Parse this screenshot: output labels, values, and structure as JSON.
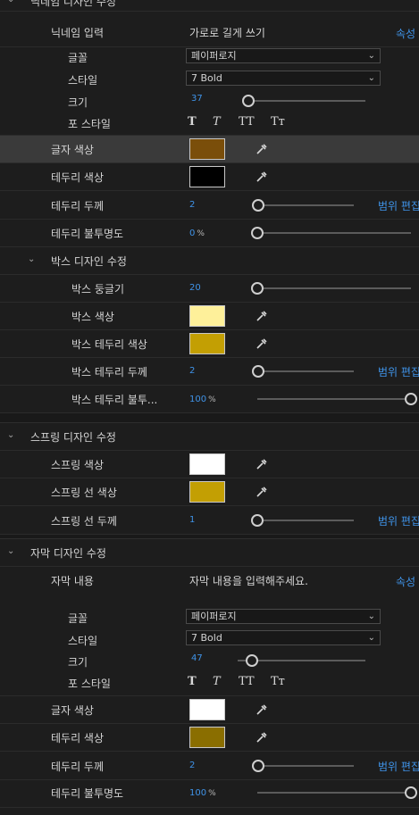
{
  "nickname_section": {
    "title": "닉네임 디자인 수정",
    "input_label": "닉네임 입력",
    "input_value": "가로로 길게 쓰기",
    "attr_link": "속성",
    "font_label": "글꼴",
    "font_value": "페이퍼로지",
    "style_label": "스타일",
    "style_value": "7 Bold",
    "size_label": "크기",
    "size_value": "37",
    "fontstyle_label": "포 스타일",
    "fontstyle_glyphs": [
      "T",
      "T",
      "TT",
      "Tт"
    ],
    "text_color_label": "글자 색상",
    "text_color": "#7a4e0a",
    "border_color_label": "테두리 색상",
    "border_color": "#000000",
    "border_width_label": "테두리 두께",
    "border_width_value": "2",
    "range_edit": "범위 편집",
    "border_opacity_label": "테두리 불투명도",
    "border_opacity_value": "0",
    "percent": "%"
  },
  "box_section": {
    "title": "박스 디자인 수정",
    "radius_label": "박스 둥글기",
    "radius_value": "20",
    "color_label": "박스 색상",
    "color": "#fef09a",
    "border_color_label": "박스 테두리 색상",
    "border_color": "#c39f03",
    "border_width_label": "박스 테두리 두께",
    "border_width_value": "2",
    "range_edit": "범위 편집",
    "border_opacity_label": "박스 테두리 불투...",
    "border_opacity_value": "100",
    "percent": "%"
  },
  "spring_section": {
    "title": "스프링 디자인 수정",
    "color_label": "스프링 색상",
    "color": "#ffffff",
    "line_color_label": "스프링 선 색상",
    "line_color": "#c39f03",
    "line_width_label": "스프링 선 두께",
    "line_width_value": "1",
    "range_edit": "범위 편집"
  },
  "caption_section": {
    "title": "자막 디자인 수정",
    "content_label": "자막 내용",
    "content_value": "자막 내용을 입력해주세요.",
    "attr_link": "속성",
    "font_label": "글꼴",
    "font_value": "페이퍼로지",
    "style_label": "스타일",
    "style_value": "7 Bold",
    "size_label": "크기",
    "size_value": "47",
    "fontstyle_label": "포 스타일",
    "fontstyle_glyphs": [
      "T",
      "T",
      "TT",
      "Tт"
    ],
    "text_color_label": "글자 색상",
    "text_color": "#ffffff",
    "border_color_label": "테두리 색상",
    "border_color": "#8a6e00",
    "border_width_label": "테두리 두께",
    "border_width_value": "2",
    "range_edit": "범위 편집",
    "border_opacity_label": "테두리 불투명도",
    "border_opacity_value": "100",
    "percent": "%"
  },
  "icons": {
    "expand": "chevron-down-icon",
    "picker": "eyedropper-icon",
    "select_arrow": "chevron-down-icon"
  }
}
